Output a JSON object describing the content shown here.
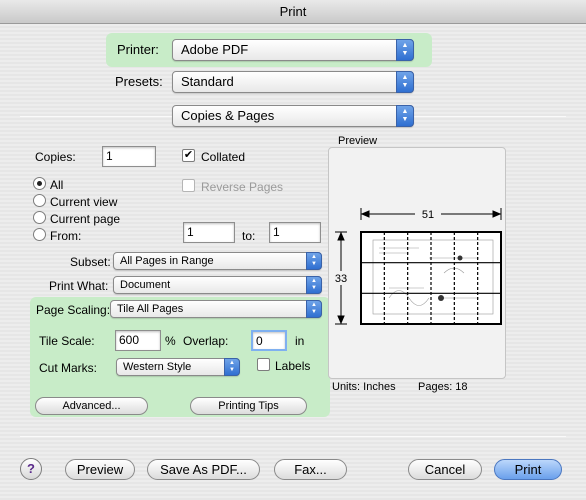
{
  "window": {
    "title": "Print"
  },
  "printer": {
    "label": "Printer:",
    "value": "Adobe PDF"
  },
  "presets": {
    "label": "Presets:",
    "value": "Standard"
  },
  "panel": {
    "value": "Copies & Pages"
  },
  "copies": {
    "label": "Copies:",
    "value": "1",
    "collated_label": "Collated",
    "collated": true,
    "reverse_label": "Reverse Pages"
  },
  "range": {
    "all": "All",
    "current_view": "Current view",
    "current_page": "Current page",
    "from_label": "From:",
    "from_value": "1",
    "to_label": "to:",
    "to_value": "1",
    "selected": "all"
  },
  "subset": {
    "label": "Subset:",
    "value": "All Pages in Range"
  },
  "print_what": {
    "label": "Print What:",
    "value": "Document"
  },
  "page_scaling": {
    "label": "Page Scaling:",
    "value": "Tile All Pages"
  },
  "tile": {
    "scale_label": "Tile Scale:",
    "scale_value": "600",
    "percent": "%",
    "overlap_label": "Overlap:",
    "overlap_value": "0",
    "unit": "in"
  },
  "cut_marks": {
    "label": "Cut Marks:",
    "value": "Western Style",
    "labels_label": "Labels"
  },
  "buttons": {
    "advanced": "Advanced...",
    "printing_tips": "Printing Tips",
    "help": "?",
    "preview": "Preview",
    "save_pdf": "Save As PDF...",
    "fax": "Fax...",
    "cancel": "Cancel",
    "print": "Print"
  },
  "preview": {
    "title": "Preview",
    "width_label": "51",
    "height_label": "33",
    "units_label": "Units: Inches",
    "pages_label": "Pages: 18",
    "columns": 6,
    "rows": 3
  },
  "colors": {
    "highlight": "#c8ecc8",
    "accent": "#2f6fd1"
  }
}
